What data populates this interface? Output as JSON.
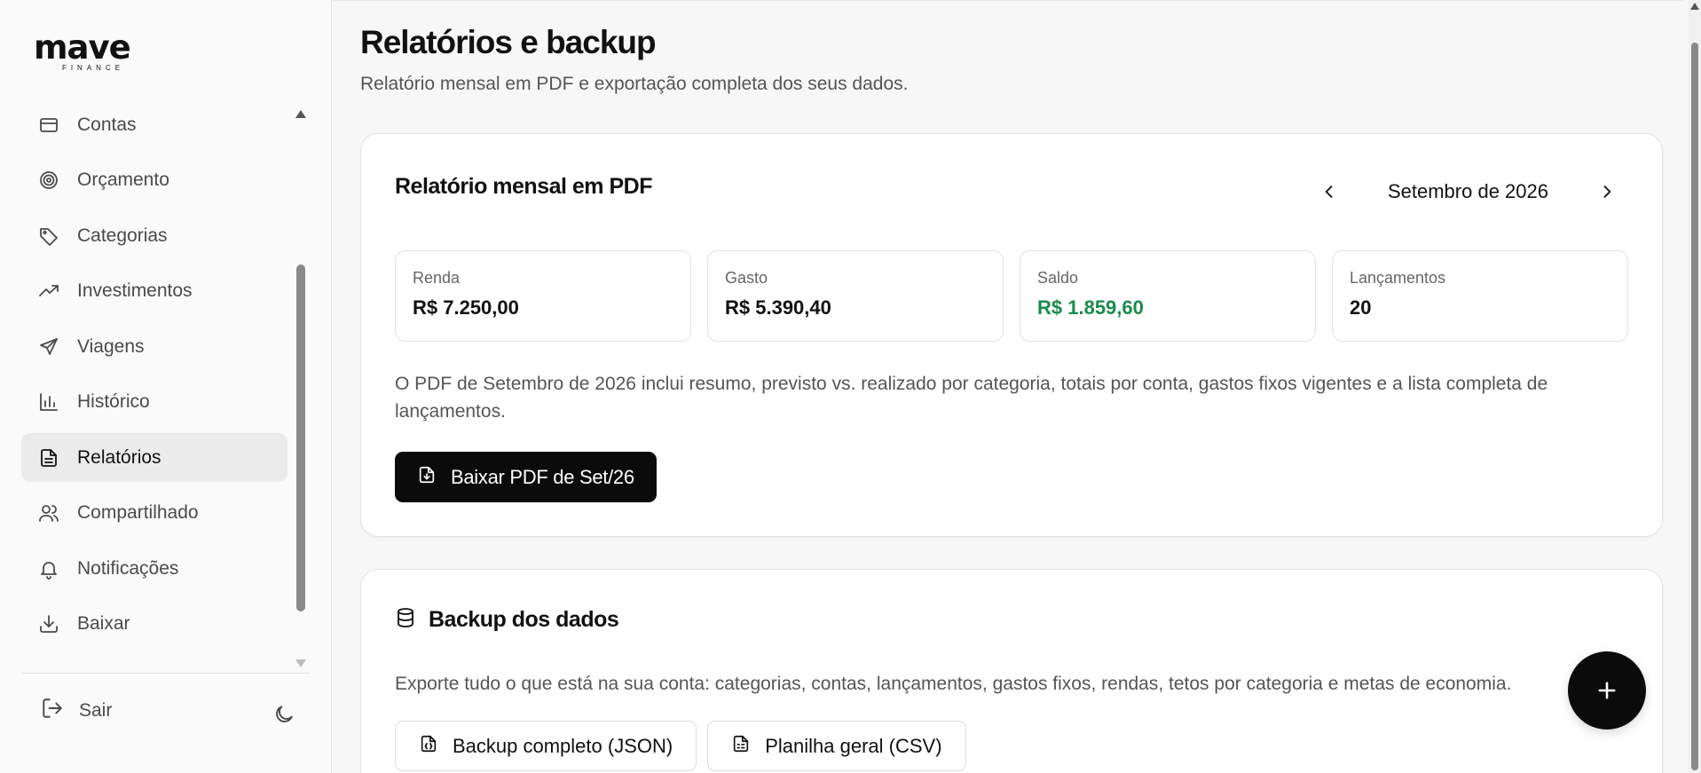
{
  "brand": {
    "name": "mave",
    "tagline": "FINANCE"
  },
  "sidebar": {
    "items": [
      {
        "label": "Contas",
        "icon": "credit-card-icon"
      },
      {
        "label": "Orçamento",
        "icon": "target-icon"
      },
      {
        "label": "Categorias",
        "icon": "tag-icon"
      },
      {
        "label": "Investimentos",
        "icon": "trending-up-icon"
      },
      {
        "label": "Viagens",
        "icon": "plane-icon"
      },
      {
        "label": "Histórico",
        "icon": "bar-chart-icon"
      },
      {
        "label": "Relatórios",
        "icon": "file-text-icon",
        "active": true
      },
      {
        "label": "Compartilhado",
        "icon": "users-icon"
      },
      {
        "label": "Notificações",
        "icon": "bell-icon"
      },
      {
        "label": "Baixar",
        "icon": "download-icon"
      }
    ],
    "logout_label": "Sair",
    "theme_icon": "moon-icon"
  },
  "page": {
    "title": "Relatórios e backup",
    "subtitle": "Relatório mensal em PDF e exportação completa dos seus dados."
  },
  "report": {
    "title": "Relatório mensal em PDF",
    "month_label": "Setembro de 2026",
    "stats": [
      {
        "label": "Renda",
        "value": "R$ 7.250,00"
      },
      {
        "label": "Gasto",
        "value": "R$ 5.390,40"
      },
      {
        "label": "Saldo",
        "value": "R$ 1.859,60",
        "color": "#1a8a4c"
      },
      {
        "label": "Lançamentos",
        "value": "20"
      }
    ],
    "description": "O PDF de Setembro de 2026 inclui resumo, previsto vs. realizado por categoria, totais por conta, gastos fixos vigentes e a lista completa de lançamentos.",
    "download_button": "Baixar PDF de Set/26"
  },
  "backup": {
    "title": "Backup dos dados",
    "description": "Exporte tudo o que está na sua conta: categorias, contas, lançamentos, gastos fixos, rendas, tetos por categoria e metas de economia.",
    "json_button": "Backup completo (JSON)",
    "csv_button": "Planilha geral (CSV)"
  },
  "fab_icon": "plus-icon",
  "colors": {
    "primary": "#0b0b0b",
    "positive": "#1a8a4c",
    "background": "#f7f7f7"
  }
}
